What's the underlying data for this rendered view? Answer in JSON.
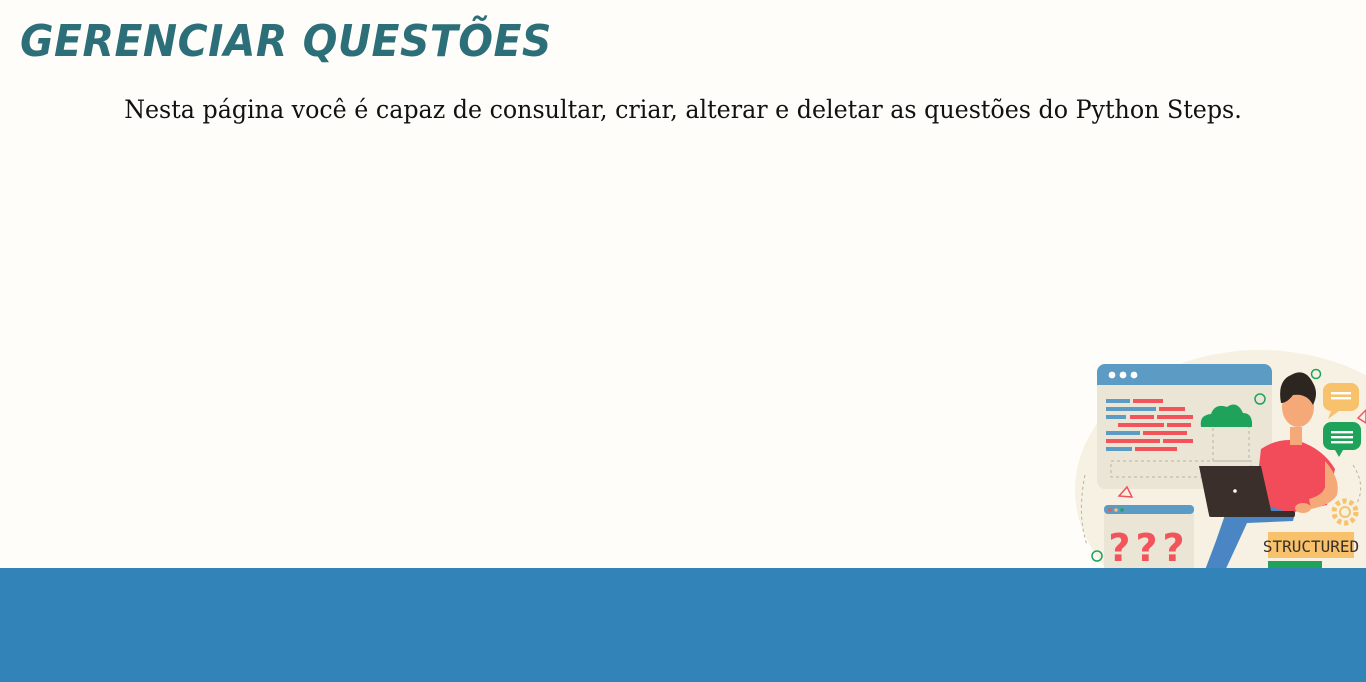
{
  "header": {
    "title": "GERENCIAR QUESTÕES",
    "subtitle": "Nesta página você é capaz de consultar, criar, alterar e deletar as questões do Python Steps."
  },
  "illustration": {
    "question_marks": "???",
    "badge_text": "STRUCTURED"
  },
  "colors": {
    "title": "#2c6f78",
    "background": "#fffdf9",
    "footer": "#3183b8",
    "illustration_window": "#5b9bc4",
    "cloud": "#1fa35b",
    "code_red": "#f2545b",
    "shirt": "#f24b5a"
  }
}
